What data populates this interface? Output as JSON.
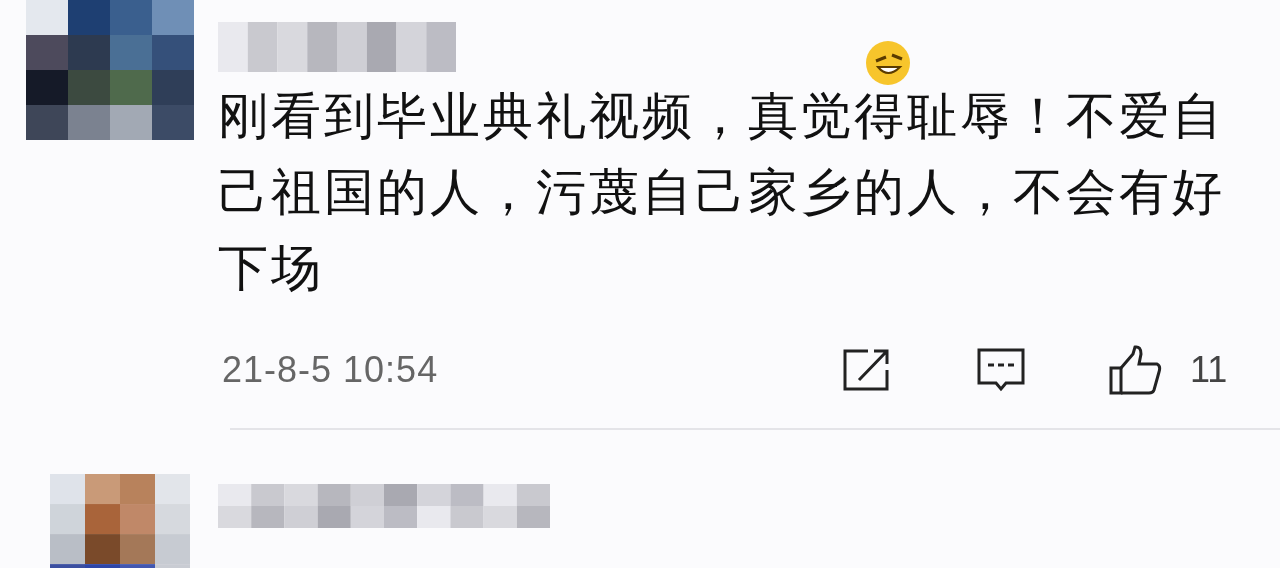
{
  "comments": [
    {
      "text": "刚看到毕业典礼视频，真觉得耻辱！不爱自己祖国的人，污蔑自己家乡的人，不会有好下场",
      "time": "21-8-5 10:54",
      "likes": "11"
    }
  ]
}
